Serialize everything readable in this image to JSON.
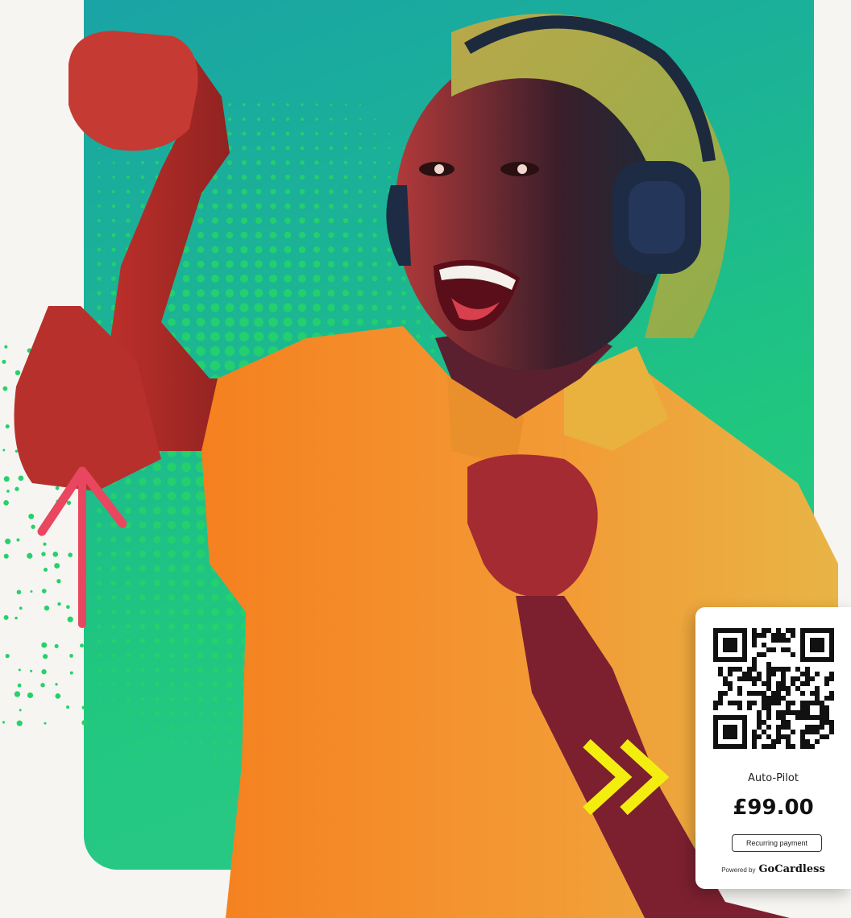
{
  "payment_card": {
    "title": "Auto-Pilot",
    "amount": "£99.00",
    "badge": "Recurring payment",
    "footer_prefix": "Powered by",
    "footer_brand": "GoCardless"
  },
  "colors": {
    "panel_top": "#1aa3a6",
    "panel_bottom": "#20c77f",
    "halftone": "#25d26a",
    "arrow": "#e8475f",
    "chevrons": "#f4ee10",
    "shirt": "#f08a2a"
  },
  "icons": [
    "qr-code-icon",
    "up-arrow-icon",
    "double-chevron-right-icon"
  ]
}
